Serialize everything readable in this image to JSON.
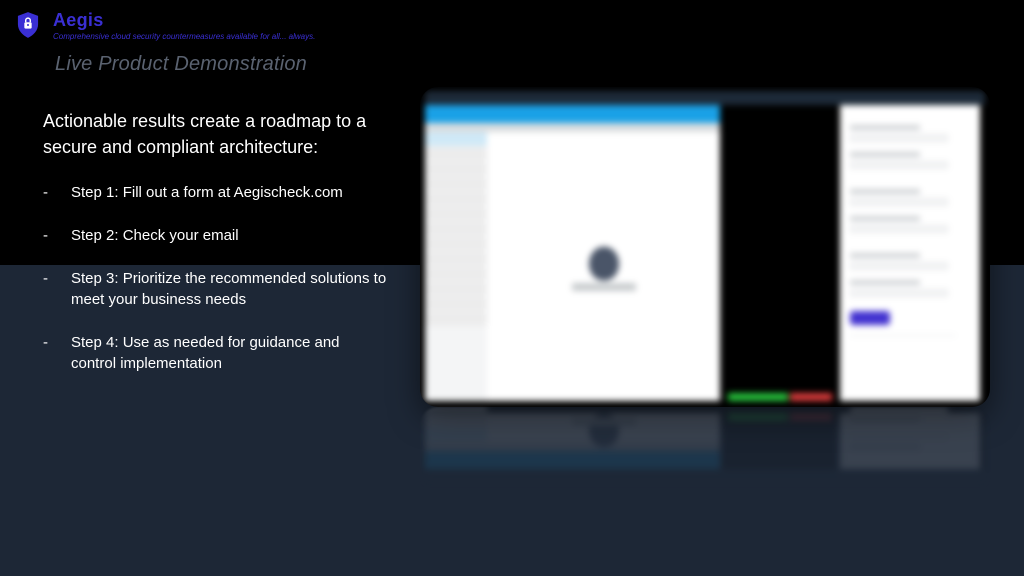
{
  "brand": {
    "name": "Aegis",
    "tagline": "Comprehensive cloud security countermeasures available for all... always."
  },
  "section_title": "Live Product Demonstration",
  "heading": "Actionable results create a roadmap to a secure and compliant architecture:",
  "steps": [
    "Step 1: Fill out a form at Aegischeck.com",
    "Step 2: Check your email",
    "Step 3: Prioritize the recommended solutions to meet your business needs",
    "Step 4: Use as needed for guidance and control implementation"
  ],
  "colors": {
    "brand": "#3a2fd4",
    "lower_bg": "#1d2736"
  }
}
